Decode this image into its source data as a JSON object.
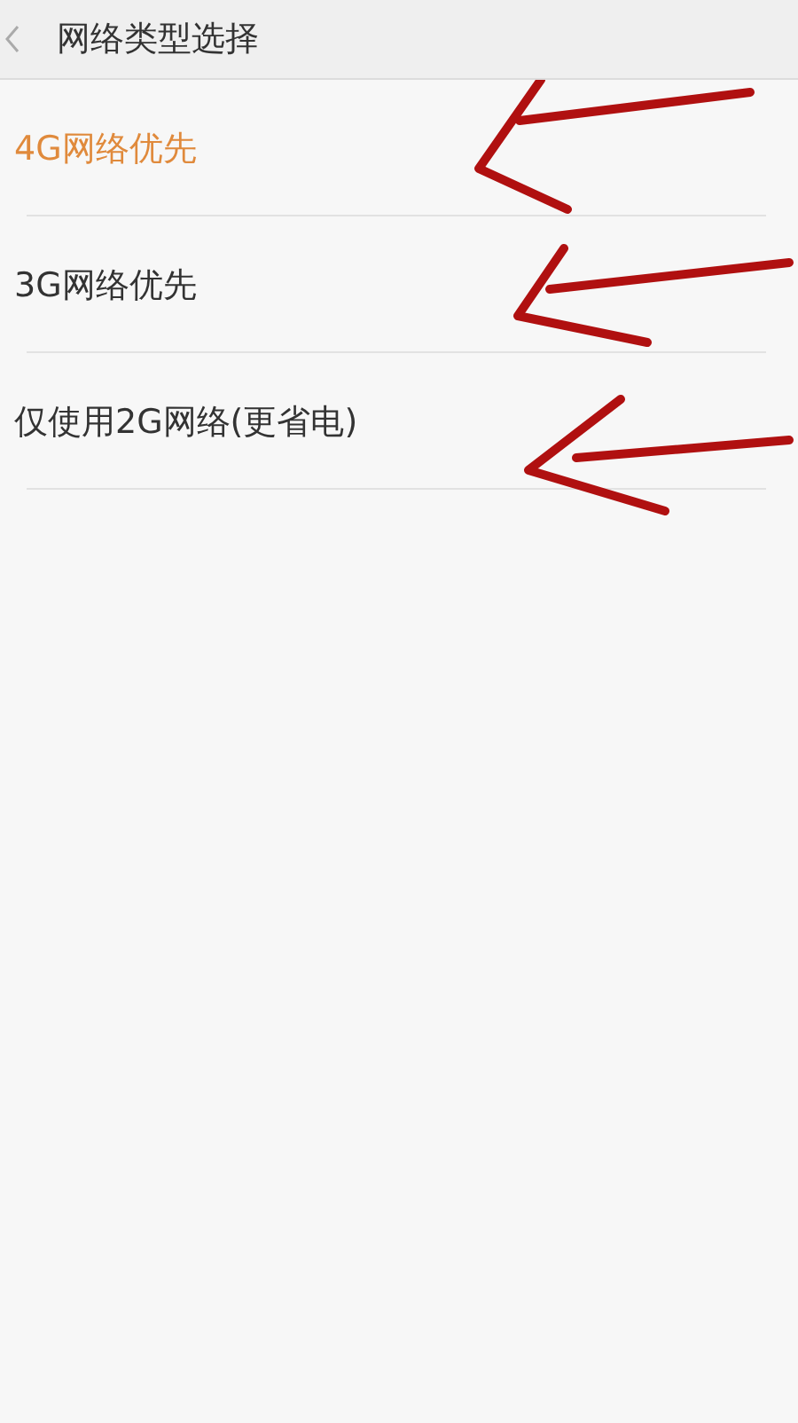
{
  "header": {
    "title": "网络类型选择"
  },
  "options": [
    {
      "label": "4G网络优先",
      "selected": true
    },
    {
      "label": "3G网络优先",
      "selected": false
    },
    {
      "label": "仅使用2G网络(更省电)",
      "selected": false
    }
  ]
}
